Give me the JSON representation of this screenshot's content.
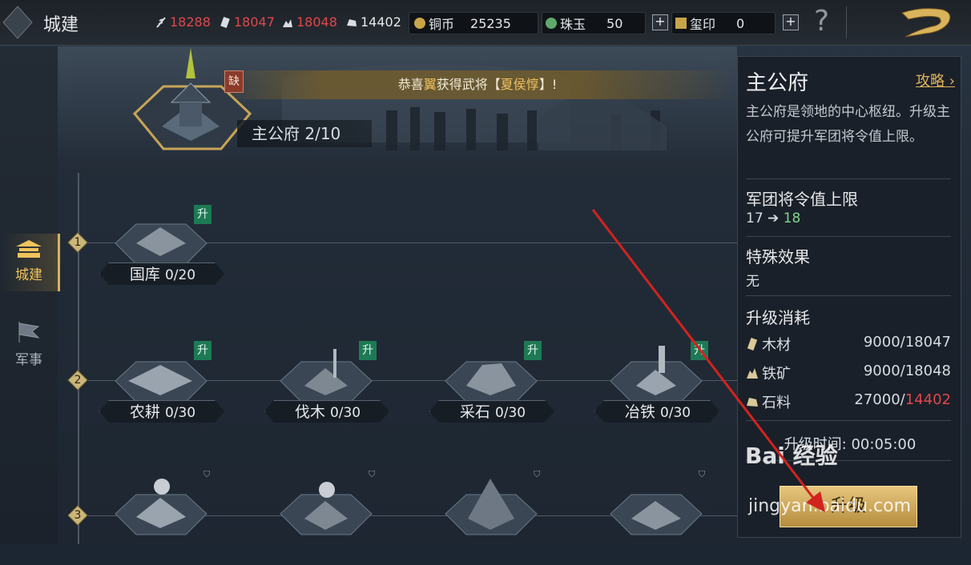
{
  "header": {
    "title": "城建",
    "resources": [
      {
        "icon": "food-icon",
        "value": "18288",
        "color": "#e0474c"
      },
      {
        "icon": "wood-icon",
        "value": "18047",
        "color": "#e0474c"
      },
      {
        "icon": "iron-icon",
        "value": "18048",
        "color": "#e0474c"
      },
      {
        "icon": "stone-icon",
        "value": "14402",
        "color": "#e6e8ea"
      }
    ],
    "copper": {
      "label": "铜币",
      "value": "25235"
    },
    "jade": {
      "label": "珠玉",
      "value": "50"
    },
    "seal": {
      "label": "玺印",
      "value": "0"
    },
    "plus": "+",
    "help": "?"
  },
  "nav": [
    {
      "label": "城建",
      "active": true
    },
    {
      "label": "军事",
      "active": false
    }
  ],
  "banner": {
    "notice_prefix": "恭喜",
    "notice_player": "翼",
    "notice_mid": "获得武将【",
    "notice_general": "夏侯惇",
    "notice_suffix": "】!",
    "main_building": "主公府",
    "main_level": "2/10",
    "lack_badge": "缺"
  },
  "tiers": [
    {
      "num": "1",
      "buildings": [
        {
          "name": "国库",
          "level": "0/20",
          "upgrade": "升"
        }
      ]
    },
    {
      "num": "2",
      "buildings": [
        {
          "name": "农耕",
          "level": "0/30",
          "upgrade": "升"
        },
        {
          "name": "伐木",
          "level": "0/30",
          "upgrade": "升"
        },
        {
          "name": "采石",
          "level": "0/30",
          "upgrade": "升"
        },
        {
          "name": "冶铁",
          "level": "0/30",
          "upgrade": "升"
        }
      ]
    },
    {
      "num": "3",
      "buildings": []
    }
  ],
  "panel": {
    "title": "主公府",
    "guide": "攻略",
    "description": "主公府是领地的中心枢纽。升级主公府可提升军团将令值上限。",
    "sec1": "军团将令值上限",
    "cap_from": "17",
    "cap_arrow": "➔",
    "cap_to": "18",
    "sec2": "特殊效果",
    "effect": "无",
    "sec3": "升级消耗",
    "costs": [
      {
        "icon": "wood-icon",
        "name": "木材",
        "need": "9000",
        "have": "18047",
        "short": false
      },
      {
        "icon": "iron-icon",
        "name": "铁矿",
        "need": "9000",
        "have": "18048",
        "short": false
      },
      {
        "icon": "stone-icon",
        "name": "石料",
        "need": "27000",
        "have": "14402",
        "short": true
      }
    ],
    "time_label": "升级时间:",
    "time_value": "00:05:00",
    "upgrade_button": "升级"
  },
  "watermark": {
    "line1": "Bai 经验",
    "line2": "jingyan.baidu.com"
  }
}
